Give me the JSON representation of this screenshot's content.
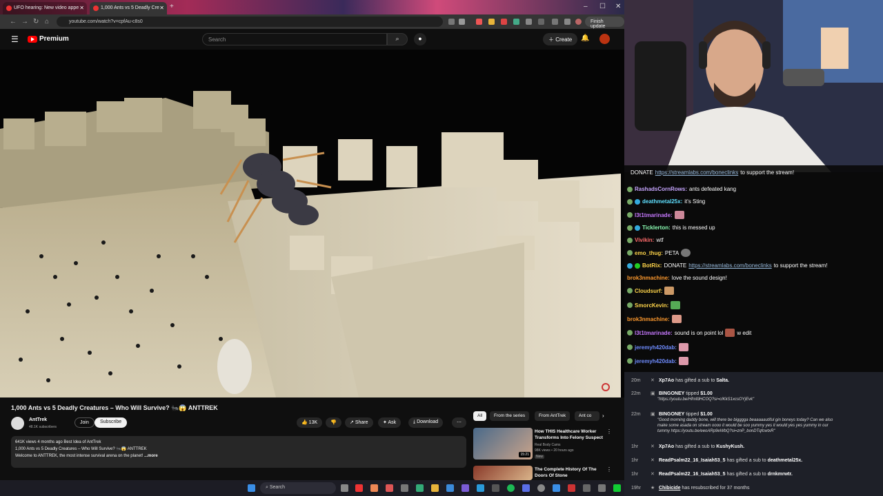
{
  "browser": {
    "tabs": [
      {
        "label": "UFO hearing: New video appe"
      },
      {
        "label": "1,000 Ants vs 5 Deadly Cre"
      }
    ],
    "url": "youtube.com/watch?v=cpfAu-c8s0",
    "finish_update": "Finish update"
  },
  "youtube": {
    "brand": "Premium",
    "search_placeholder": "Search",
    "create_label": "Create"
  },
  "video": {
    "title": "1,000 Ants vs 5 Deadly Creatures – Who Will Survive? 🐜😱 ANTTREK",
    "channel": "AntTrek",
    "subscribers": "48.1K subscribers",
    "join_label": "Join",
    "subscribe_label": "Subscribe",
    "likes": "13K",
    "share_label": "Share",
    "ask_label": "Ask",
    "download_label": "Download",
    "more_label": "⋯",
    "description": {
      "stats": "641K views  4 months ago  Best Idea of AntTrek",
      "line1": "1,000 Ants vs 5 Deadly Creatures – Who Will Survive? 🐜😱 ANTTREK",
      "line2": "Welcome to ANTTREK, the most intense survival arena on the planet!",
      "more": "...more"
    }
  },
  "recommendations": {
    "chips": [
      "All",
      "From the series",
      "From AntTrek",
      "Ant co"
    ],
    "items": [
      {
        "title": "How THIS Healthcare Worker Transforms Into Felony Suspect",
        "channel": "Real Body Cams",
        "meta": "98K views • 20 hours ago",
        "badge": "New",
        "duration": "15:21"
      },
      {
        "title": "The Complete History Of The Doors Of Stone",
        "channel": "",
        "meta": "",
        "badge": "",
        "duration": ""
      }
    ]
  },
  "chat": {
    "pinned": {
      "prefix": "DONATE",
      "link": "https://streamlabs.com/boneclinks",
      "suffix": "to support the stream!"
    },
    "messages": [
      {
        "user": "RashadsCornRows:",
        "text": "ants defeated kang",
        "color": "#c7a6ff"
      },
      {
        "user": "deathmetal25x:",
        "text": "it's Sting",
        "color": "#5fe0ff"
      },
      {
        "user": "l3t1tmarinade:",
        "text": "",
        "color": "#c779ff"
      },
      {
        "user": "Ticklerton:",
        "text": "this is messed up",
        "color": "#8cffb5"
      },
      {
        "user": "Vivikin:",
        "text": "wtf",
        "color": "#ff6b6b"
      },
      {
        "user": "emo_thug:",
        "text": "PETA",
        "color": "#ffd54a"
      },
      {
        "user": "BotRix:",
        "text": "DONATE",
        "color": "#ffd54a",
        "link": "https://streamlabs.com/boneclinks",
        "suffix": "to support the stream!"
      },
      {
        "user": "brok3nmachine:",
        "text": "love the sound design!",
        "color": "#ff9a2e"
      },
      {
        "user": "Cloudsurf:",
        "text": "",
        "color": "#ffd54a"
      },
      {
        "user": "SmorcKevin:",
        "text": "",
        "color": "#ffd54a"
      },
      {
        "user": "brok3nmachine:",
        "text": "",
        "color": "#ff9a2e"
      },
      {
        "user": "l3t1tmarinade:",
        "text": "sound is on point lol",
        "text2": "w edit",
        "color": "#c779ff"
      },
      {
        "user": "jeremyh420dab:",
        "text": "",
        "color": "#6f8cff"
      },
      {
        "user": "jeremyh420dab:",
        "text": "",
        "color": "#6f8cff"
      }
    ]
  },
  "events": [
    {
      "time": "20m",
      "user": "Xp7Ao",
      "action": "has gifted a sub to",
      "target": "Salta."
    },
    {
      "time": "22m",
      "user": "BINGONEY",
      "action": "tipped",
      "target": "$1.00",
      "note": "\"https://youtu.be/HfmfdHCOQ?si=cIKkS1xcsOYjEvk\""
    },
    {
      "time": "22m",
      "user": "BINGONEY",
      "action": "tipped",
      "target": "$1.00",
      "note": "\"Good morning daddy bone, will there be bigggga beaaaaautiful gin boneys today? Can we also",
      "note2": "make some asada on stream oooo it would be soo yummy yes it would yes yes yummy in our",
      "note3": "tummy https://youtu.be/eeoARp9eWbQ?si=znP_bonDTqfcwtxR\""
    },
    {
      "time": "1hr",
      "user": "Xp7Ao",
      "action": "has gifted a sub to",
      "target": "KushyKush."
    },
    {
      "time": "1hr",
      "user": "ReadPsalm22_16_Isaiah53_5",
      "action": "has gifted a sub to",
      "target": "deathmetal25x."
    },
    {
      "time": "1hr",
      "user": "ReadPsalm22_16_Isaiah53_5",
      "action": "has gifted a sub to",
      "target": "drnkmrwtr."
    },
    {
      "time": "19hr",
      "user": "Chibicide",
      "action": "has resubscribed for 37 months",
      "target": ""
    }
  ],
  "taskbar": {
    "search_label": "Search"
  }
}
